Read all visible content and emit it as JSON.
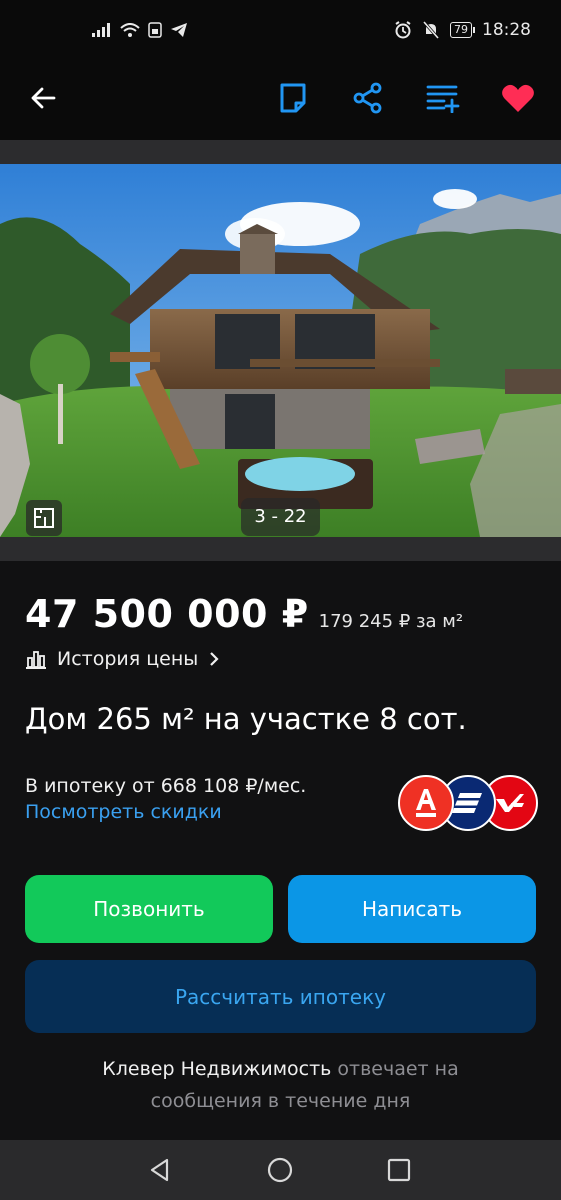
{
  "status_bar": {
    "time": "18:28",
    "battery": "79",
    "icons": [
      "signal-icon",
      "wifi-icon",
      "sim-icon",
      "telegram-icon",
      "alarm-icon",
      "mute-icon"
    ]
  },
  "app_bar": {
    "icons": [
      "back-arrow-icon",
      "note-icon",
      "share-icon",
      "compare-list-icon",
      "heart-icon"
    ],
    "accent": "#2196f3",
    "favorite_color": "#ff2d55"
  },
  "gallery": {
    "counter": "3 - 22"
  },
  "listing": {
    "price": "47 500 000 ₽",
    "price_per_m2": "179 245 ₽ за м²",
    "price_history": "История цены",
    "title": "Дом 265 м² на участке 8 сот."
  },
  "mortgage": {
    "from_text": "В ипотеку от 668 108 ₽/мес.",
    "discounts_link": "Посмотреть скидки",
    "banks": [
      {
        "name": "alfa-bank",
        "color": "#ef3124"
      },
      {
        "name": "vtb",
        "color": "#0a2973"
      },
      {
        "name": "post-bank",
        "color": "#e30613"
      }
    ]
  },
  "actions": {
    "call": "Позвонить",
    "write": "Написать",
    "calculate": "Рассчитать ипотеку"
  },
  "agency": {
    "name": "Клевер Недвижимость",
    "response_line1": "отвечает на",
    "response_line2": "сообщения в течение дня"
  }
}
